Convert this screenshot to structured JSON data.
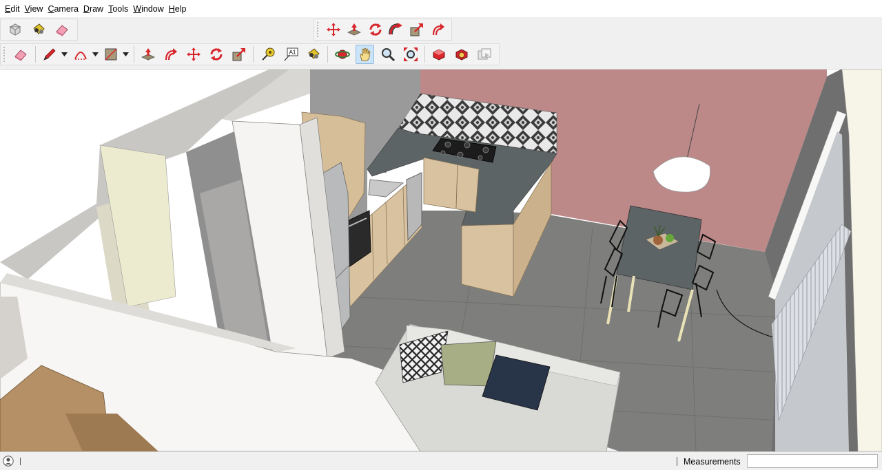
{
  "menu": {
    "items": [
      {
        "label": "Edit",
        "key": "E",
        "rest": "dit"
      },
      {
        "label": "View",
        "key": "V",
        "rest": "iew"
      },
      {
        "label": "Camera",
        "key": "C",
        "rest": "amera"
      },
      {
        "label": "Draw",
        "key": "D",
        "rest": "raw"
      },
      {
        "label": "Tools",
        "key": "T",
        "rest": "ools"
      },
      {
        "label": "Window",
        "key": "W",
        "rest": "indow"
      },
      {
        "label": "Help",
        "key": "H",
        "rest": "elp"
      }
    ]
  },
  "toolbar": {
    "row1_left": [
      "make-component-icon",
      "paint-bucket-icon",
      "eraser-icon"
    ],
    "row1_right": [
      "move-icon",
      "push-pull-icon",
      "rotate-icon",
      "follow-me-icon",
      "scale-icon",
      "offset-icon"
    ],
    "row2_text_tool": "A1",
    "active_tool": "pan-icon"
  },
  "status": {
    "measurements_label": "Measurements",
    "measurements_value": ""
  },
  "colors": {
    "accent_wall": "#bc8888",
    "floor": "#7e7e7c",
    "countertop": "#5d6466",
    "wood": "#d8c2a0",
    "sofa": "#d9d9d6",
    "cushion_green": "#a7ae85",
    "cushion_navy": "#283447",
    "wall_white": "#f8f6f4",
    "tool_red": "#d8262c"
  }
}
